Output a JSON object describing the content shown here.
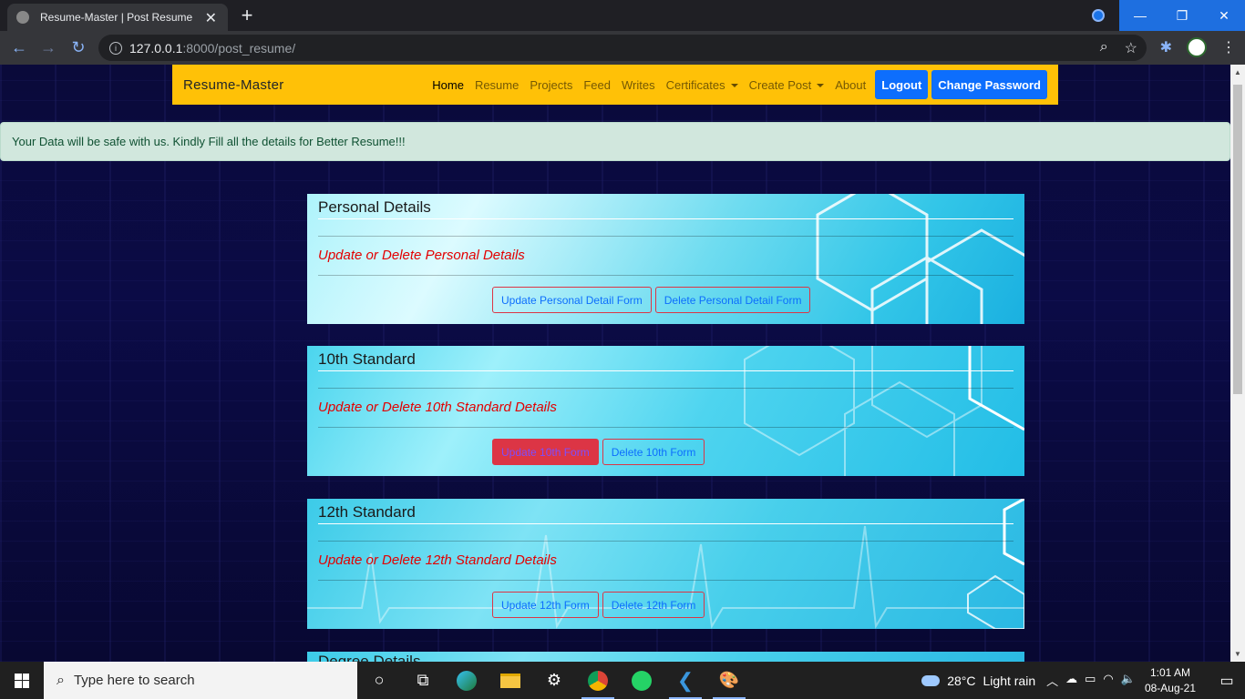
{
  "browser": {
    "tab_title": "Resume-Master | Post Resume",
    "tab_close": "✕",
    "new_tab": "+",
    "url_host": "127.0.0.1",
    "url_rest": ":8000/post_resume/",
    "window_controls": {
      "minimize": "—",
      "restore": "❐",
      "close": "✕"
    }
  },
  "navbar": {
    "brand": "Resume-Master",
    "links": [
      "Home",
      "Resume",
      "Projects",
      "Feed",
      "Writes"
    ],
    "dropdowns": [
      "Certificates",
      "Create Post"
    ],
    "about": "About",
    "logout": "Logout",
    "change_password": "Change Password"
  },
  "alert": {
    "text": "Your Data will be safe with us. Kindly Fill all the details for Better Resume!!!"
  },
  "cards": [
    {
      "title": "Personal Details",
      "subtitle": "Update or Delete Personal Details",
      "update_label": "Update Personal Detail Form",
      "delete_label": "Delete Personal Detail Form"
    },
    {
      "title": "10th Standard",
      "subtitle": "Update or Delete 10th Standard Details",
      "update_label": "Update 10th Form",
      "delete_label": "Delete 10th Form"
    },
    {
      "title": "12th Standard",
      "subtitle": "Update or Delete 12th Standard Details",
      "update_label": "Update 12th Form",
      "delete_label": "Delete 12th Form"
    },
    {
      "title": "Degree Details"
    }
  ],
  "taskbar": {
    "search_placeholder": "Type here to search",
    "weather_temp": "28°C",
    "weather_text": "Light rain",
    "time": "1:01 AM",
    "date": "08-Aug-21"
  },
  "colors": {
    "navbar": "#ffc107",
    "primary": "#0d6efd",
    "danger": "#dc3545",
    "alert_bg": "#d1e7dd"
  }
}
